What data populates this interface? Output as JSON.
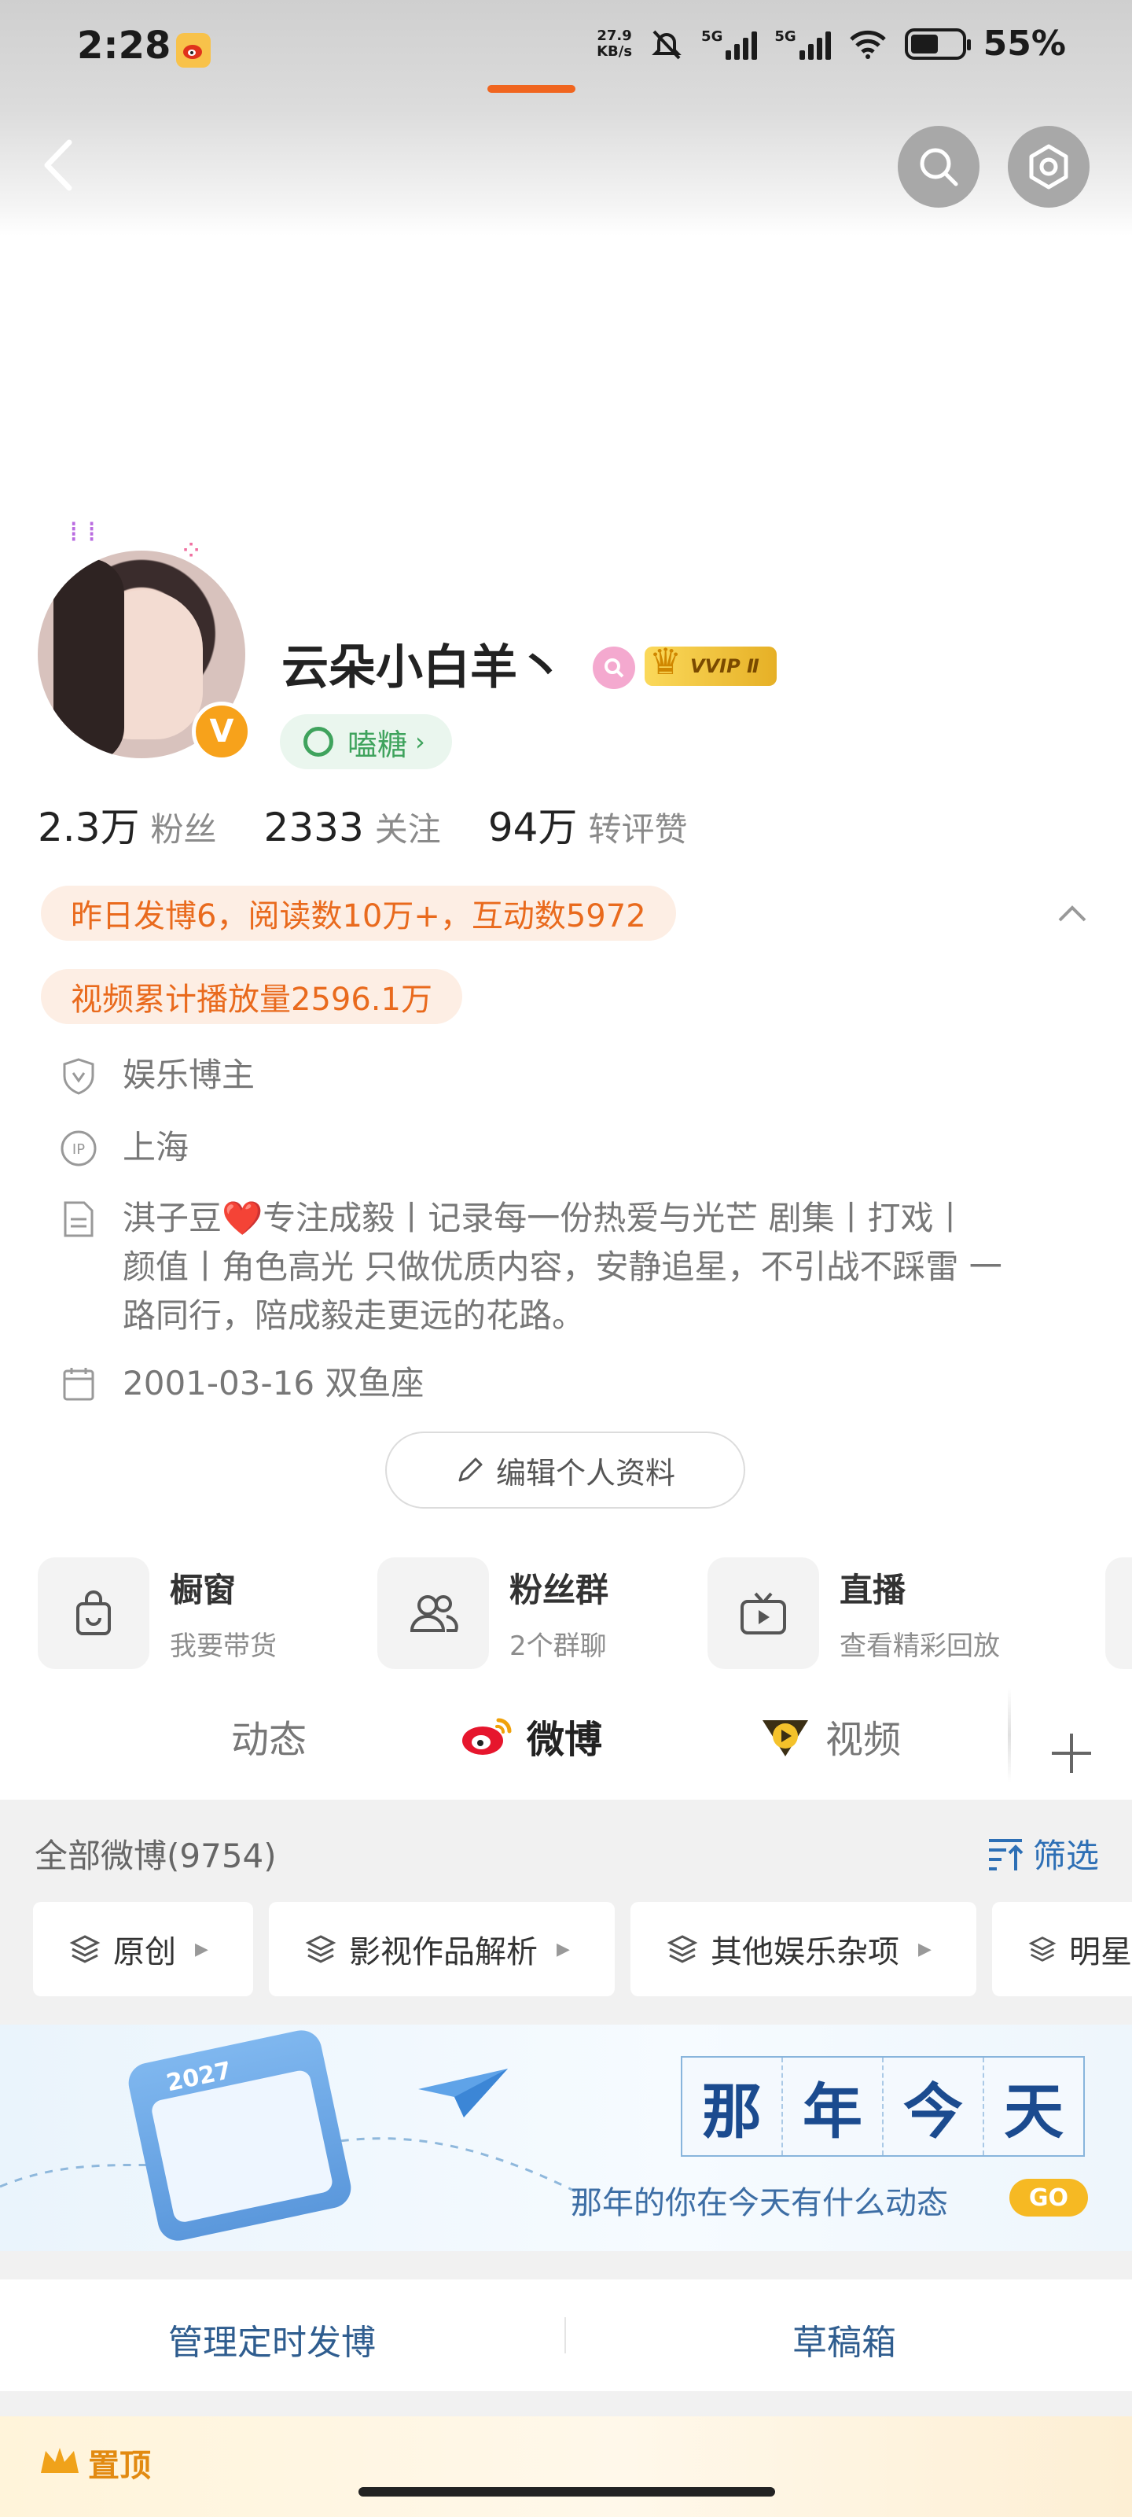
{
  "status_bar": {
    "time": "2:28",
    "net_speed_top": "27.9",
    "net_speed_unit": "KB/s",
    "sim1": "5G",
    "sim2": "5G",
    "battery": "55%"
  },
  "profile": {
    "username": "云朵小白羊丶",
    "vip_badge": "VVIP Ⅱ",
    "tag_label": "嗑糖",
    "stats": [
      {
        "num": "2.3万",
        "label": "粉丝"
      },
      {
        "num": "2333",
        "label": "关注"
      },
      {
        "num": "94万",
        "label": "转评赞"
      }
    ],
    "highlight_1": "昨日发博6，阅读数10万+，互动数5972",
    "highlight_2": "视频累计播放量2596.1万",
    "category": "娱乐博主",
    "ip_location": "上海",
    "bio_line1": "淇子豆❤️专注成毅丨记录每一份热爱与光芒 剧集丨打戏丨",
    "bio_line2": "颜值丨角色高光 只做优质内容，安静追星，不引战不踩雷 一",
    "bio_line3": "路同行，陪成毅走更远的花路。",
    "birthday": "2001-03-16 双鱼座",
    "edit_button": "编辑个人资料"
  },
  "features": [
    {
      "title": "橱窗",
      "sub": "我要带货"
    },
    {
      "title": "粉丝群",
      "sub": "2个群聊"
    },
    {
      "title": "直播",
      "sub": "查看精彩回放"
    }
  ],
  "tabs": [
    {
      "label": "动态"
    },
    {
      "label": "微博"
    },
    {
      "label": "视频"
    }
  ],
  "feed": {
    "header": "全部微博(9754)",
    "filter_label": "筛选",
    "chips": [
      "原创",
      "影视作品解析",
      "其他娱乐杂项",
      "明星"
    ],
    "banner_chars": [
      "那",
      "年",
      "今",
      "天"
    ],
    "banner_year": "2027",
    "banner_sub": "那年的你在今天有什么动态",
    "banner_go": "GO",
    "manage_scheduled": "管理定时发博",
    "drafts": "草稿箱",
    "bottom_label": "置顶"
  },
  "colors": {
    "accent_orange": "#f0651f",
    "link_blue": "#2d6fb5",
    "tag_green": "#3fa35d"
  }
}
